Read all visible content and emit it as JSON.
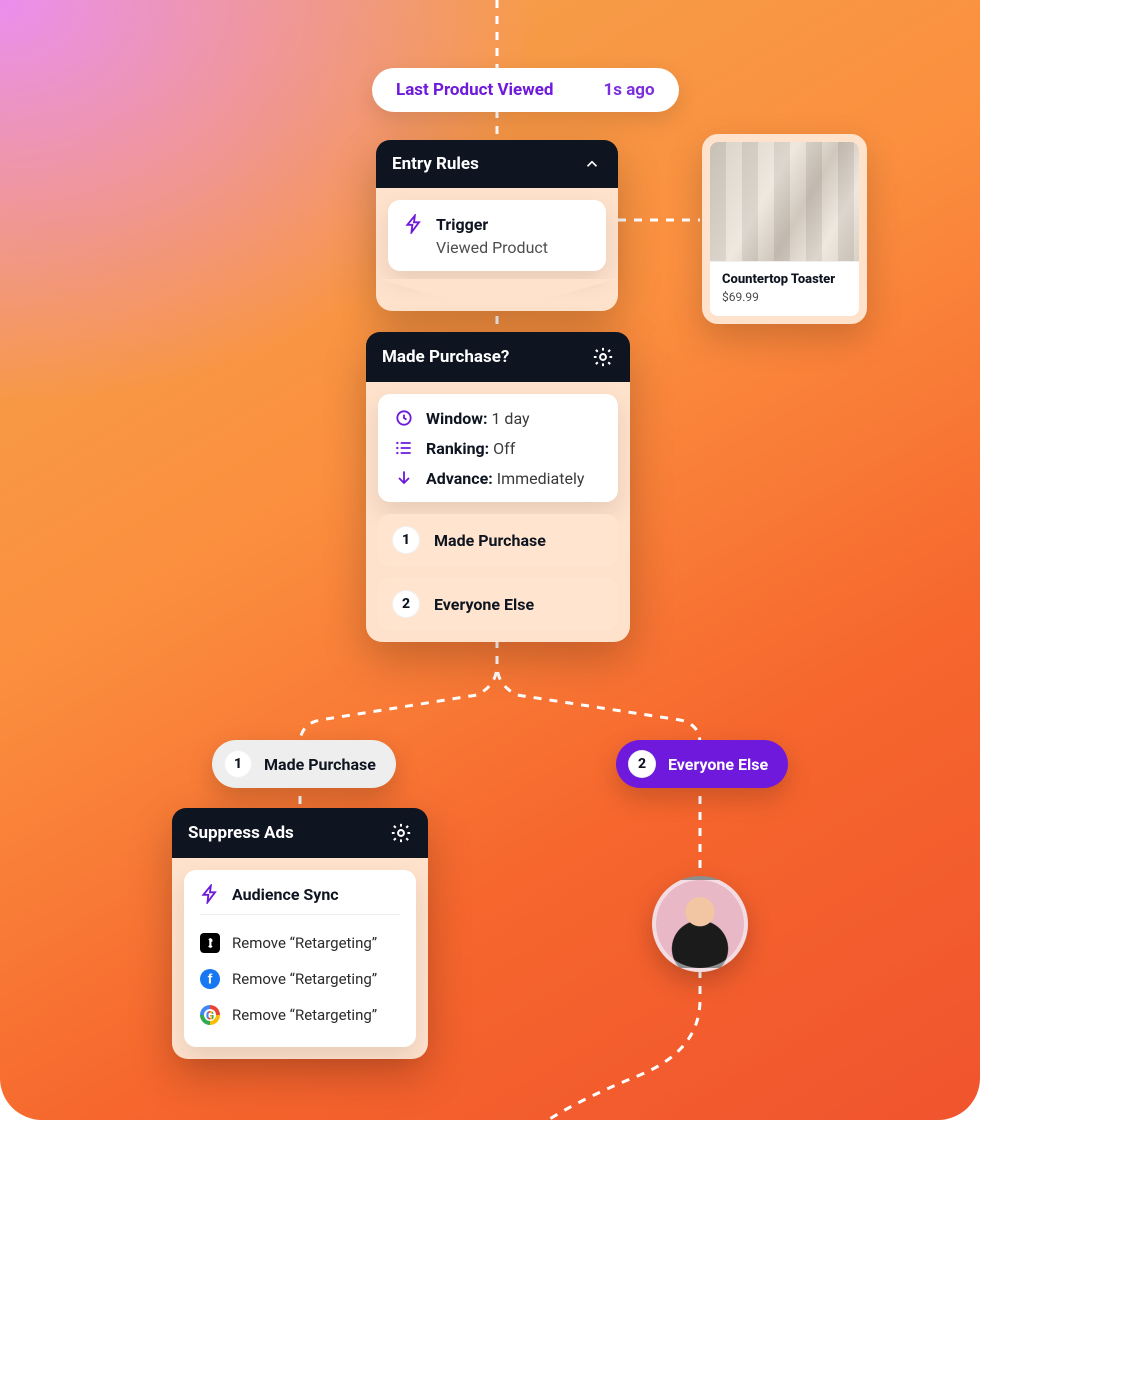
{
  "topPill": {
    "title": "Last Product Viewed",
    "meta": "1s ago"
  },
  "entryRules": {
    "title": "Entry Rules",
    "trigger": {
      "label": "Trigger",
      "value": "Viewed Product"
    }
  },
  "product": {
    "name": "Countertop Toaster",
    "price": "$69.99"
  },
  "decision": {
    "title": "Made Purchase?",
    "settings": [
      {
        "icon": "clock",
        "label": "Window:",
        "value": "1 day"
      },
      {
        "icon": "list",
        "label": "Ranking:",
        "value": "Off"
      },
      {
        "icon": "arrow",
        "label": "Advance:",
        "value": "Immediately"
      }
    ],
    "options": [
      "Made Purchase",
      "Everyone Else"
    ]
  },
  "branches": {
    "left": {
      "num": "1",
      "label": "Made Purchase"
    },
    "right": {
      "num": "2",
      "label": "Everyone Else"
    }
  },
  "suppress": {
    "title": "Suppress Ads",
    "syncTitle": "Audience Sync",
    "rows": [
      {
        "brand": "t",
        "text": "Remove “Retargeting”"
      },
      {
        "brand": "f",
        "text": "Remove “Retargeting”"
      },
      {
        "brand": "g",
        "text": "Remove “Retargeting”"
      }
    ]
  }
}
